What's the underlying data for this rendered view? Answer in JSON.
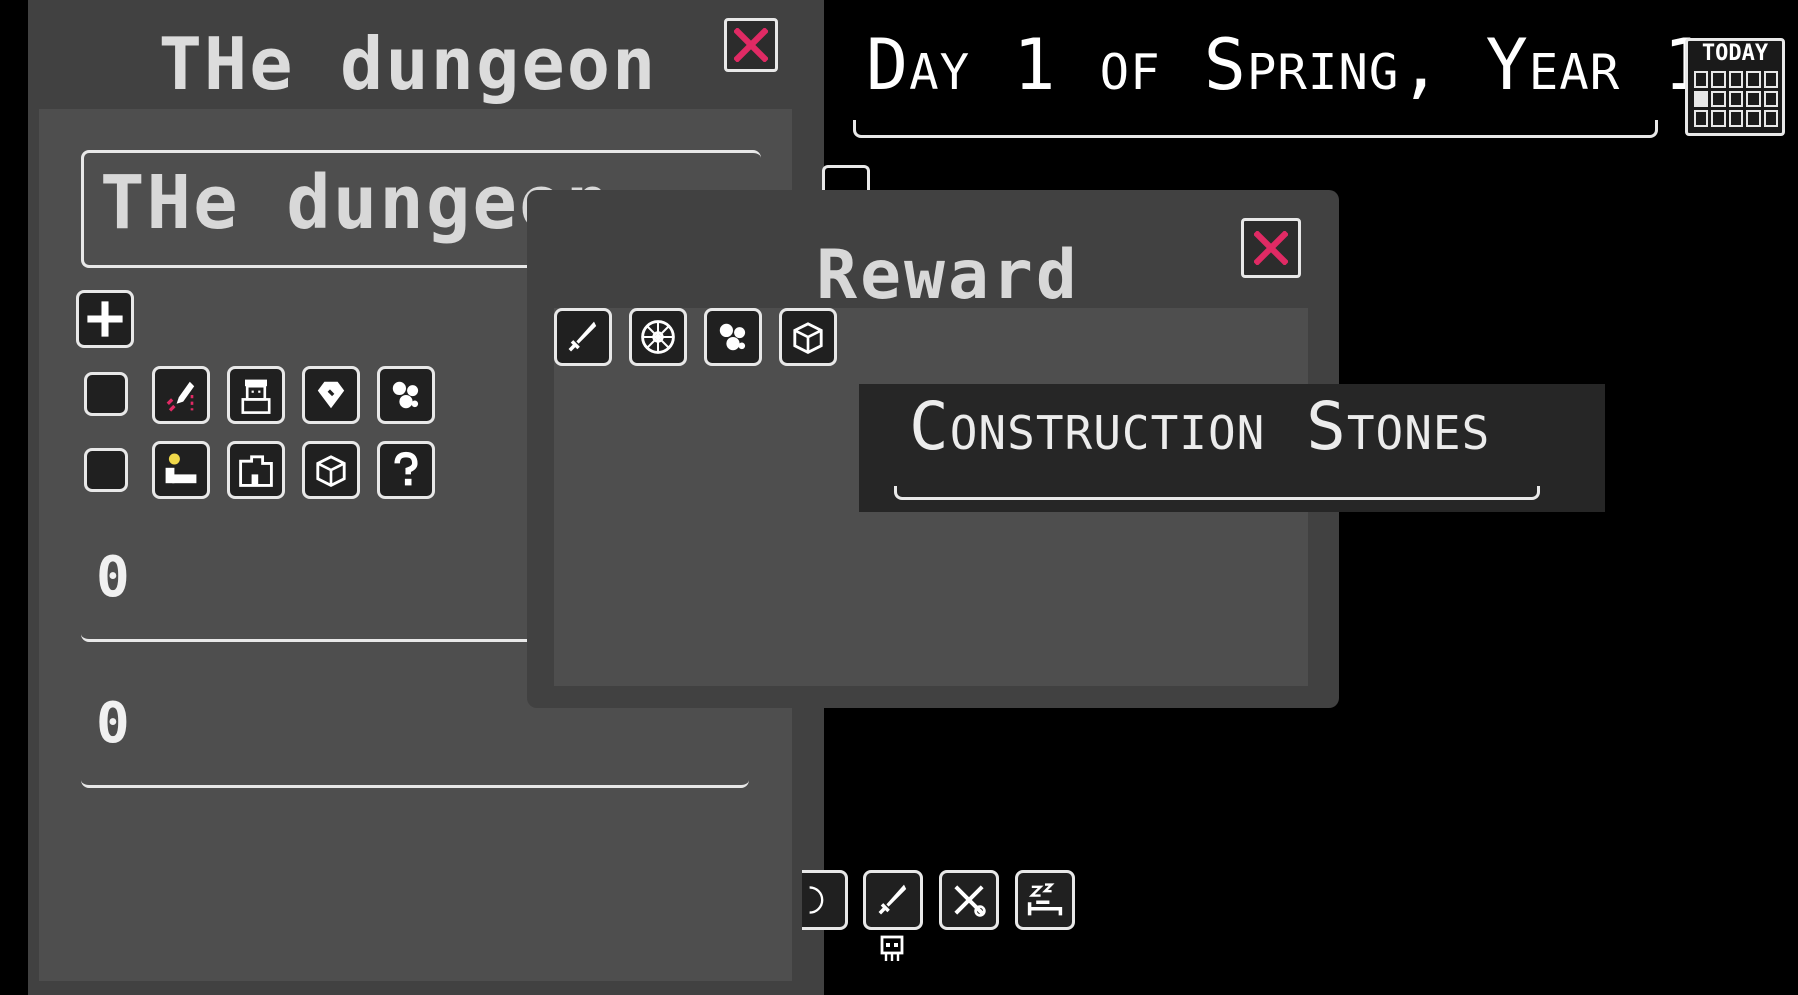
{
  "left_panel": {
    "title": "THe dungeon",
    "name_value": "THe dungeon",
    "number_1": "0",
    "number_2": "0"
  },
  "reward_panel": {
    "title": "Reward",
    "tooltip": "Construction Stones"
  },
  "header": {
    "date": "Day 1 of Spring, Year 1",
    "calendar_label": "TODAY"
  },
  "icons": {
    "row1": [
      "rocket-icon",
      "npc-icon",
      "gem-icon",
      "critters-icon"
    ],
    "row2": [
      "bed-icon",
      "building-icon",
      "crate-icon",
      "question-icon"
    ],
    "reward": [
      "sword-icon",
      "wheel-icon",
      "critters-icon",
      "crate-icon"
    ],
    "bottom": [
      "wheel-icon",
      "sword-icon",
      "tools-icon",
      "sleep-icon"
    ]
  },
  "colors": {
    "accent": "#e02a64",
    "panel": "#414141",
    "panel_inner": "#4e4e4e",
    "outline": "#e8e8e8",
    "background": "#000000"
  }
}
